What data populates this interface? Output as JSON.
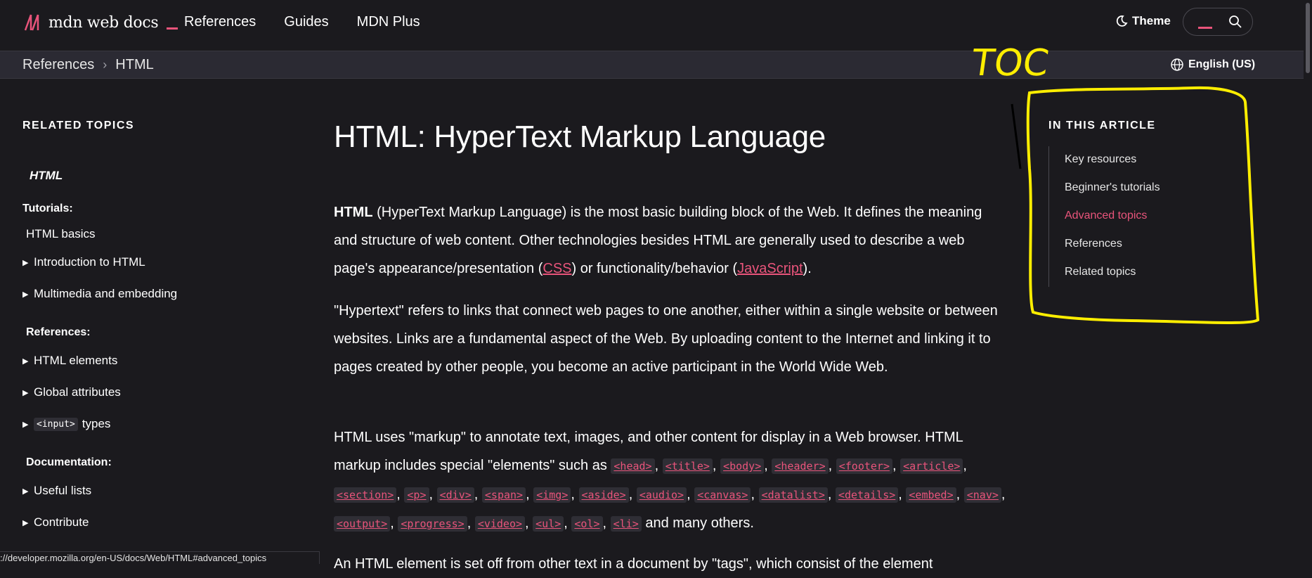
{
  "header": {
    "logo_text": "mdn web docs",
    "nav": [
      "References",
      "Guides",
      "MDN Plus"
    ],
    "theme_label": "Theme"
  },
  "breadcrumb": {
    "items": [
      "References",
      "HTML"
    ],
    "language": "English (US)"
  },
  "sidebar": {
    "heading": "RELATED TOPICS",
    "current": "HTML",
    "tutorials_label": "Tutorials:",
    "html_basics": "HTML basics",
    "intro": "Introduction to HTML",
    "multimedia": "Multimedia and embedding",
    "references_label": "References:",
    "html_elements": "HTML elements",
    "global_attributes": "Global attributes",
    "input_code": "<input>",
    "input_types": "types",
    "documentation_label": "Documentation:",
    "useful_lists": "Useful lists",
    "contribute": "Contribute"
  },
  "article": {
    "title": "HTML: HyperText Markup Language",
    "p1_bold": "HTML",
    "p1_a": " (HyperText Markup Language) is the most basic building block of the Web. It defines the meaning and structure of web content. Other technologies besides HTML are generally used to describe a web page's appearance/presentation (",
    "p1_css": "CSS",
    "p1_b": ") or functionality/behavior (",
    "p1_js": "JavaScript",
    "p1_c": ").",
    "p2": "\"Hypertext\" refers to links that connect web pages to one another, either within a single website or between websites. Links are a fundamental aspect of the Web. By uploading content to the Internet and linking it to pages created by other people, you become an active participant in the World Wide Web.",
    "p3_intro": "HTML uses \"markup\" to annotate text, images, and other content for display in a Web browser. HTML markup includes special \"elements\" such as ",
    "p3_tags": [
      "<head>",
      "<title>",
      "<body>",
      "<header>",
      "<footer>",
      "<article>",
      "<section>",
      "<p>",
      "<div>",
      "<span>",
      "<img>",
      "<aside>",
      "<audio>",
      "<canvas>",
      "<datalist>",
      "<details>",
      "<embed>",
      "<nav>",
      "<output>",
      "<progress>",
      "<video>",
      "<ul>",
      "<ol>",
      "<li>"
    ],
    "p3_end": " and many others.",
    "p4_partial": "An HTML element is set off from other text in a document by \"tags\", which consist of the element"
  },
  "toc": {
    "heading": "IN THIS ARTICLE",
    "items": [
      "Key resources",
      "Beginner's tutorials",
      "Advanced topics",
      "References",
      "Related topics"
    ],
    "active_index": 2
  },
  "status_url": "://developer.mozilla.org/en-US/docs/Web/HTML#advanced_topics",
  "annotation": {
    "label": "TOC",
    "color": "#ffee00"
  },
  "colors": {
    "background": "#1b1a1e",
    "accent": "#e9547b",
    "bar": "#2b2a33"
  }
}
